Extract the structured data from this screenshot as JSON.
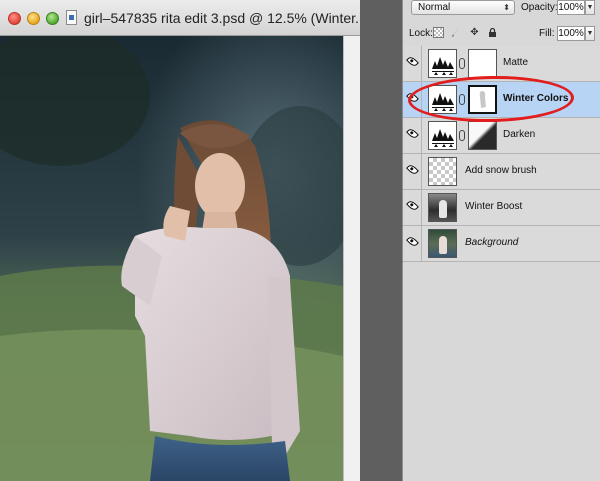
{
  "window": {
    "title": "girl–547835 rita edit 3.psd @ 12.5% (Winter..."
  },
  "layers_panel": {
    "blend_mode": "Normal",
    "opacity_label": "Opacity:",
    "opacity_value": "100%",
    "lock_label": "Lock:",
    "fill_label": "Fill:",
    "fill_value": "100%",
    "layers": [
      {
        "name": "Matte",
        "kind": "adjustment",
        "mask": "white",
        "selected": false,
        "visible": true
      },
      {
        "name": "Winter Colors",
        "kind": "adjustment",
        "mask": "selected-mask",
        "selected": true,
        "visible": true
      },
      {
        "name": "Darken",
        "kind": "adjustment",
        "mask": "dark",
        "selected": false,
        "visible": true
      },
      {
        "name": "Add snow brush",
        "kind": "pixel-transparent",
        "selected": false,
        "visible": true
      },
      {
        "name": "Winter Boost",
        "kind": "pixel-bw",
        "selected": false,
        "visible": true
      },
      {
        "name": "Background",
        "kind": "pixel-color",
        "selected": false,
        "visible": true
      }
    ]
  },
  "colors": {
    "selected_layer": "#b8d4f4",
    "annotation_red": "#e21d1d",
    "panel_bg": "#d8d8d8"
  }
}
